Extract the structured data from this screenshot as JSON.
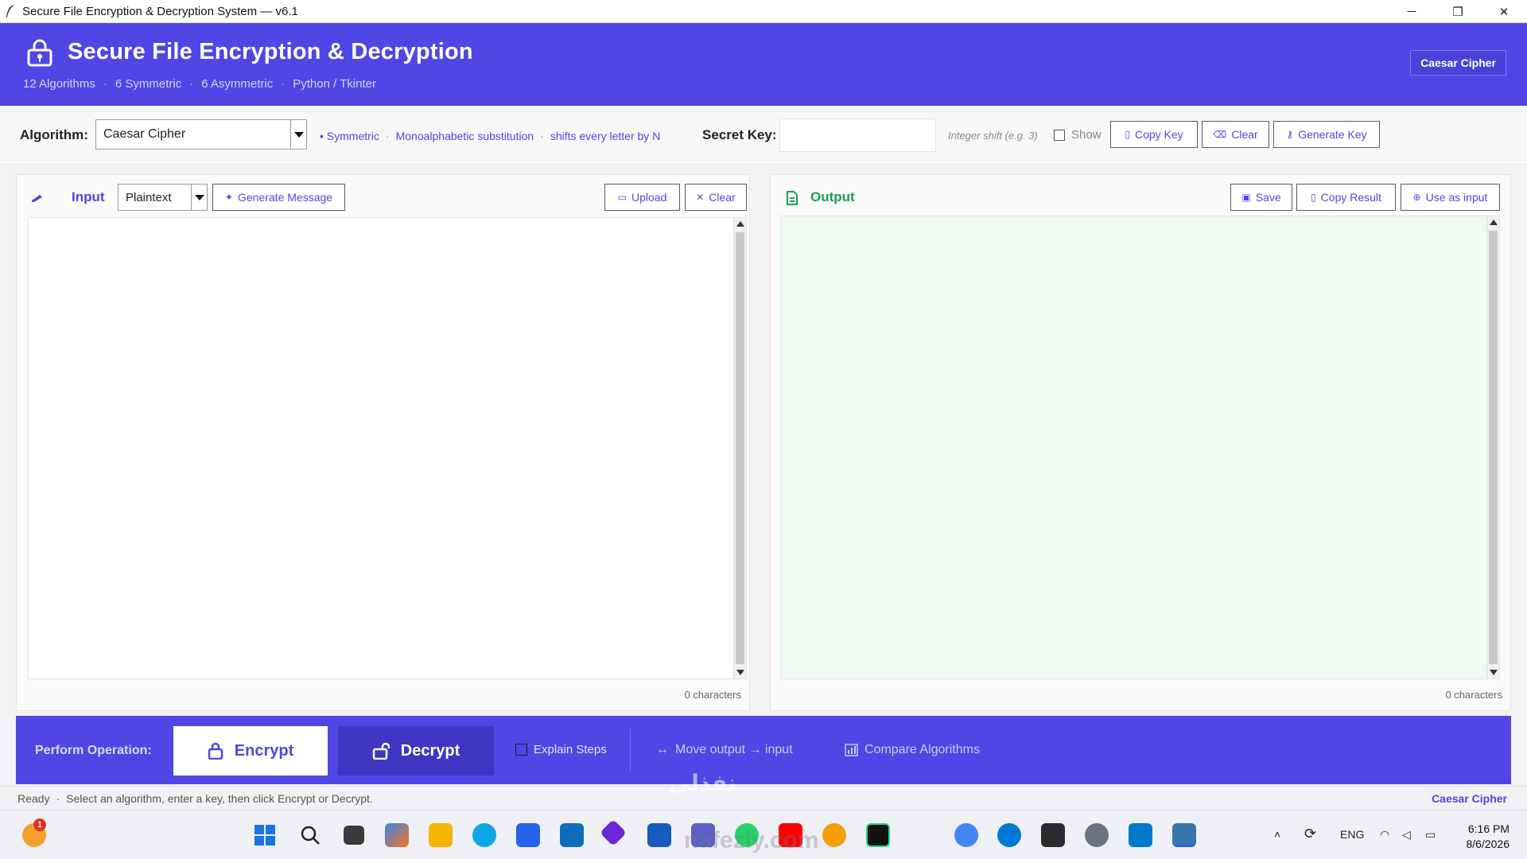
{
  "window": {
    "title": "Secure File Encryption & Decryption System  —  v6.1",
    "controls": [
      "─",
      "❐",
      "✕"
    ]
  },
  "header": {
    "title": "Secure File Encryption & Decryption",
    "subtitle": [
      "12 Algorithms",
      "6 Symmetric",
      "6 Asymmetric",
      "Python / Tkinter"
    ],
    "badge": "Caesar Cipher"
  },
  "algorithm_bar": {
    "label": "Algorithm:",
    "selected": "Caesar Cipher",
    "tags": [
      "• Symmetric",
      "Monoalphabetic substitution",
      "shifts every letter by N"
    ],
    "key_label": "Secret Key:",
    "key_value": "",
    "key_hint": "Integer shift (e.g. 3)",
    "show_label": "Show",
    "copy_key": "Copy Key",
    "clear": "Clear",
    "generate_key": "Generate Key"
  },
  "input_panel": {
    "title": "Input",
    "mode": "Plaintext",
    "generate_message": "Generate Message",
    "upload": "Upload",
    "clear": "Clear",
    "text": "",
    "char_count": "0 characters"
  },
  "output_panel": {
    "title": "Output",
    "save": "Save",
    "copy_result": "Copy Result",
    "use_as_input": "Use as input",
    "text": "",
    "char_count": "0 characters"
  },
  "operation_bar": {
    "label": "Perform Operation:",
    "encrypt": "Encrypt",
    "decrypt": "Decrypt",
    "explain_steps": "Explain Steps",
    "move_output": "Move output → input",
    "compare": "Compare Algorithms"
  },
  "status_bar": {
    "state": "Ready",
    "message": "Select an algorithm, enter a key, then click Encrypt or Decrypt.",
    "algorithm": "Caesar Cipher"
  },
  "taskbar": {
    "language": "ENG",
    "time": "6:16 PM",
    "date": "8/6/2026",
    "notification_count": "1"
  },
  "watermark": {
    "arabic": "نفذلي",
    "site": "nafezly.com"
  },
  "colors": {
    "accent": "#4f46e5",
    "accent_dark": "#3f37c4",
    "output_bg": "#eefbf1",
    "output_title": "#1f9d55"
  }
}
